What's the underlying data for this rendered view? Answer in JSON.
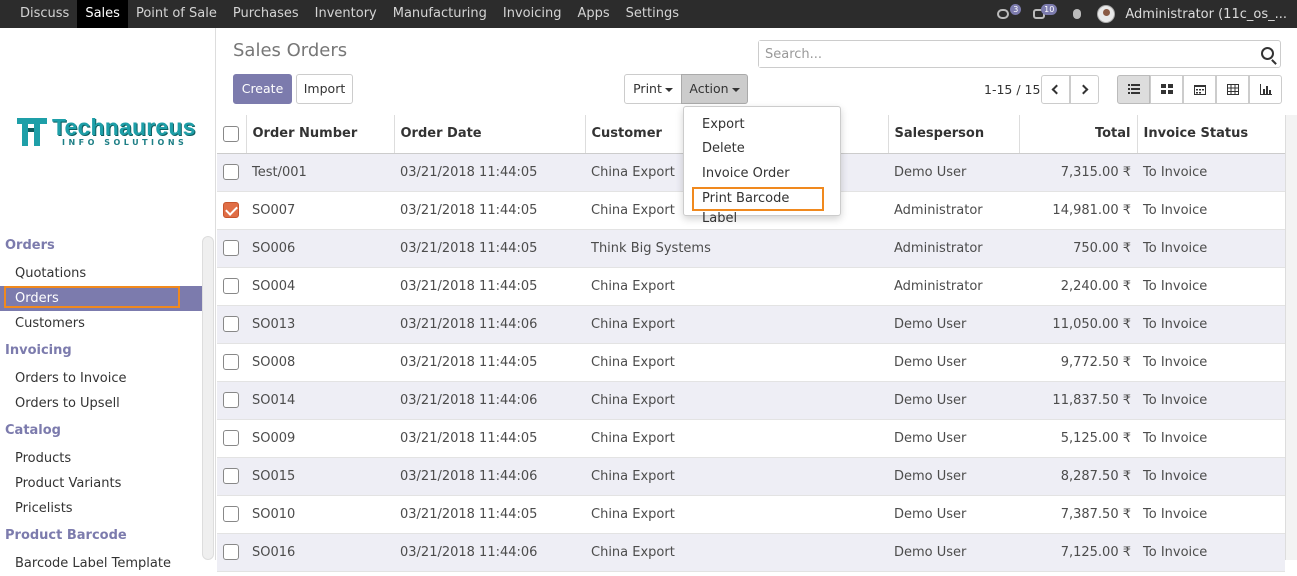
{
  "topbar": {
    "menu": [
      "Discuss",
      "Sales",
      "Point of Sale",
      "Purchases",
      "Inventory",
      "Manufacturing",
      "Invoicing",
      "Apps",
      "Settings"
    ],
    "active_menu": "Sales",
    "chat_badge": "3",
    "messages_badge": "10",
    "user": "Administrator (11c_os_..."
  },
  "logo": {
    "word": "Technaureus",
    "sub": "INFO SOLUTIONS"
  },
  "sidebar": {
    "orders_head": "Orders",
    "quotations": "Quotations",
    "orders": "Orders",
    "customers": "Customers",
    "invoicing_head": "Invoicing",
    "orders_to_invoice": "Orders to Invoice",
    "orders_to_upsell": "Orders to Upsell",
    "catalog_head": "Catalog",
    "products": "Products",
    "product_variants": "Product Variants",
    "pricelists": "Pricelists",
    "barcode_head": "Product Barcode",
    "barcode_label_template": "Barcode Label Template"
  },
  "control": {
    "title": "Sales Orders",
    "create": "Create",
    "import": "Import",
    "print": "Print",
    "action": "Action",
    "search_placeholder": "Search...",
    "pager": "1-15 / 15"
  },
  "action_menu": [
    "Export",
    "Delete",
    "Invoice Order",
    "Print Barcode Label"
  ],
  "table": {
    "headers": {
      "order_number": "Order Number",
      "order_date": "Order Date",
      "customer": "Customer",
      "salesperson": "Salesperson",
      "total": "Total",
      "invoice_status": "Invoice Status"
    },
    "rows": [
      {
        "number": "Test/001",
        "date": "03/21/2018 11:44:05",
        "customer": "China Export",
        "salesperson": "Demo User",
        "total": "7,315.00 ₹",
        "status": "To Invoice",
        "checked": false
      },
      {
        "number": "SO007",
        "date": "03/21/2018 11:44:05",
        "customer": "China Export",
        "salesperson": "Administrator",
        "total": "14,981.00 ₹",
        "status": "To Invoice",
        "checked": true
      },
      {
        "number": "SO006",
        "date": "03/21/2018 11:44:05",
        "customer": "Think Big Systems",
        "salesperson": "Administrator",
        "total": "750.00 ₹",
        "status": "To Invoice",
        "checked": false
      },
      {
        "number": "SO004",
        "date": "03/21/2018 11:44:05",
        "customer": "China Export",
        "salesperson": "Administrator",
        "total": "2,240.00 ₹",
        "status": "To Invoice",
        "checked": false
      },
      {
        "number": "SO013",
        "date": "03/21/2018 11:44:06",
        "customer": "China Export",
        "salesperson": "Demo User",
        "total": "11,050.00 ₹",
        "status": "To Invoice",
        "checked": false
      },
      {
        "number": "SO008",
        "date": "03/21/2018 11:44:05",
        "customer": "China Export",
        "salesperson": "Demo User",
        "total": "9,772.50 ₹",
        "status": "To Invoice",
        "checked": false
      },
      {
        "number": "SO014",
        "date": "03/21/2018 11:44:06",
        "customer": "China Export",
        "salesperson": "Demo User",
        "total": "11,837.50 ₹",
        "status": "To Invoice",
        "checked": false
      },
      {
        "number": "SO009",
        "date": "03/21/2018 11:44:05",
        "customer": "China Export",
        "salesperson": "Demo User",
        "total": "5,125.00 ₹",
        "status": "To Invoice",
        "checked": false
      },
      {
        "number": "SO015",
        "date": "03/21/2018 11:44:06",
        "customer": "China Export",
        "salesperson": "Demo User",
        "total": "8,287.50 ₹",
        "status": "To Invoice",
        "checked": false
      },
      {
        "number": "SO010",
        "date": "03/21/2018 11:44:05",
        "customer": "China Export",
        "salesperson": "Demo User",
        "total": "7,387.50 ₹",
        "status": "To Invoice",
        "checked": false
      },
      {
        "number": "SO016",
        "date": "03/21/2018 11:44:06",
        "customer": "China Export",
        "salesperson": "Demo User",
        "total": "7,125.00 ₹",
        "status": "To Invoice",
        "checked": false
      }
    ]
  }
}
